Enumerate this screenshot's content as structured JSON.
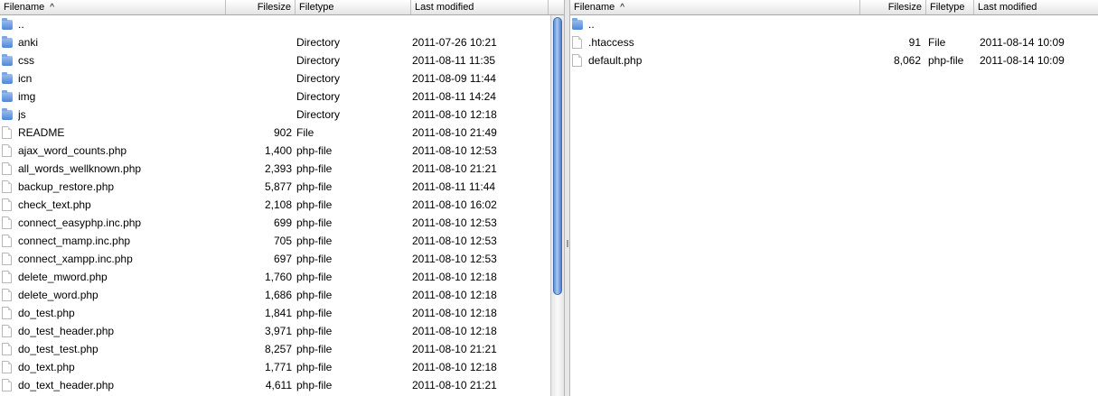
{
  "left": {
    "headers": {
      "filename": "Filename",
      "filesize": "Filesize",
      "filetype": "Filetype",
      "modified": "Last modified"
    },
    "sort_arrow": "^",
    "rows": [
      {
        "icon": "folder",
        "name": "..",
        "size": "",
        "type": "",
        "modified": ""
      },
      {
        "icon": "folder",
        "name": "anki",
        "size": "",
        "type": "Directory",
        "modified": "2011-07-26 10:21"
      },
      {
        "icon": "folder",
        "name": "css",
        "size": "",
        "type": "Directory",
        "modified": "2011-08-11 11:35"
      },
      {
        "icon": "folder",
        "name": "icn",
        "size": "",
        "type": "Directory",
        "modified": "2011-08-09 11:44"
      },
      {
        "icon": "folder",
        "name": "img",
        "size": "",
        "type": "Directory",
        "modified": "2011-08-11 14:24"
      },
      {
        "icon": "folder",
        "name": "js",
        "size": "",
        "type": "Directory",
        "modified": "2011-08-10 12:18"
      },
      {
        "icon": "file",
        "name": "README",
        "size": "902",
        "type": "File",
        "modified": "2011-08-10 21:49"
      },
      {
        "icon": "file",
        "name": "ajax_word_counts.php",
        "size": "1,400",
        "type": "php-file",
        "modified": "2011-08-10 12:53"
      },
      {
        "icon": "file",
        "name": "all_words_wellknown.php",
        "size": "2,393",
        "type": "php-file",
        "modified": "2011-08-10 21:21"
      },
      {
        "icon": "file",
        "name": "backup_restore.php",
        "size": "5,877",
        "type": "php-file",
        "modified": "2011-08-11 11:44"
      },
      {
        "icon": "file",
        "name": "check_text.php",
        "size": "2,108",
        "type": "php-file",
        "modified": "2011-08-10 16:02"
      },
      {
        "icon": "file",
        "name": "connect_easyphp.inc.php",
        "size": "699",
        "type": "php-file",
        "modified": "2011-08-10 12:53"
      },
      {
        "icon": "file",
        "name": "connect_mamp.inc.php",
        "size": "705",
        "type": "php-file",
        "modified": "2011-08-10 12:53"
      },
      {
        "icon": "file",
        "name": "connect_xampp.inc.php",
        "size": "697",
        "type": "php-file",
        "modified": "2011-08-10 12:53"
      },
      {
        "icon": "file",
        "name": "delete_mword.php",
        "size": "1,760",
        "type": "php-file",
        "modified": "2011-08-10 12:18"
      },
      {
        "icon": "file",
        "name": "delete_word.php",
        "size": "1,686",
        "type": "php-file",
        "modified": "2011-08-10 12:18"
      },
      {
        "icon": "file",
        "name": "do_test.php",
        "size": "1,841",
        "type": "php-file",
        "modified": "2011-08-10 12:18"
      },
      {
        "icon": "file",
        "name": "do_test_header.php",
        "size": "3,971",
        "type": "php-file",
        "modified": "2011-08-10 12:18"
      },
      {
        "icon": "file",
        "name": "do_test_test.php",
        "size": "8,257",
        "type": "php-file",
        "modified": "2011-08-10 21:21"
      },
      {
        "icon": "file",
        "name": "do_text.php",
        "size": "1,771",
        "type": "php-file",
        "modified": "2011-08-10 12:18"
      },
      {
        "icon": "file",
        "name": "do_text_header.php",
        "size": "4,611",
        "type": "php-file",
        "modified": "2011-08-10 21:21"
      }
    ]
  },
  "right": {
    "headers": {
      "filename": "Filename",
      "filesize": "Filesize",
      "filetype": "Filetype",
      "modified": "Last modified"
    },
    "sort_arrow": "^",
    "rows": [
      {
        "icon": "folder",
        "name": "..",
        "size": "",
        "type": "",
        "modified": ""
      },
      {
        "icon": "file",
        "name": ".htaccess",
        "size": "91",
        "type": "File",
        "modified": "2011-08-14 10:09"
      },
      {
        "icon": "file",
        "name": "default.php",
        "size": "8,062",
        "type": "php-file",
        "modified": "2011-08-14 10:09"
      }
    ]
  },
  "scroll": {
    "left_thumb_fraction": 0.74,
    "left_thumb_offset": 0.0
  }
}
